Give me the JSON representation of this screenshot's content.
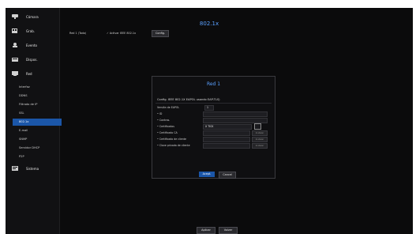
{
  "sidebar": {
    "sections": [
      {
        "label": "Cámara",
        "icon": "camera-icon"
      },
      {
        "label": "Grab.",
        "icon": "record-icon"
      },
      {
        "label": "Evento",
        "icon": "event-icon"
      },
      {
        "label": "Dispos.",
        "icon": "device-icon"
      },
      {
        "label": "Red",
        "icon": "network-icon"
      }
    ],
    "network_items": [
      {
        "label": "Interfaz"
      },
      {
        "label": "DDNS"
      },
      {
        "label": "Filtrado de IP"
      },
      {
        "label": "SSL"
      },
      {
        "label": "802.1x"
      },
      {
        "label": "E-mail"
      },
      {
        "label": "SNMP"
      },
      {
        "label": "Servidor DHCP"
      },
      {
        "label": "P2P"
      }
    ],
    "system_section": {
      "label": "Sistema",
      "icon": "system-icon"
    }
  },
  "page": {
    "title": "802.1x",
    "row_label": "Red 1 (Todo)",
    "activate_label": "Activar IEEE 802.1x",
    "config_button": "Config."
  },
  "dialog": {
    "title": "Red 1",
    "subtitle": "Config. IEEE 802.1X EAPOL usando EAP-TLS)",
    "fields": [
      {
        "label": "Versión de EAPOL",
        "value": "1"
      },
      {
        "label": "• ID",
        "value": ""
      },
      {
        "label": "• Contras.",
        "value": ""
      },
      {
        "label": "• Certificados",
        "value": "X TICK"
      },
      {
        "label": "• Certificado CA",
        "value": "",
        "button": "Instalar"
      },
      {
        "label": "• Certificado de cliente",
        "value": "",
        "button": "Instalar"
      },
      {
        "label": "• Clave privada de cliente",
        "value": "",
        "button": "Instalar"
      }
    ],
    "ok_button": "Acept.",
    "cancel_button": "Cancel"
  },
  "bottom": {
    "apply_button": "Aplicar",
    "back_button": "Volver"
  }
}
